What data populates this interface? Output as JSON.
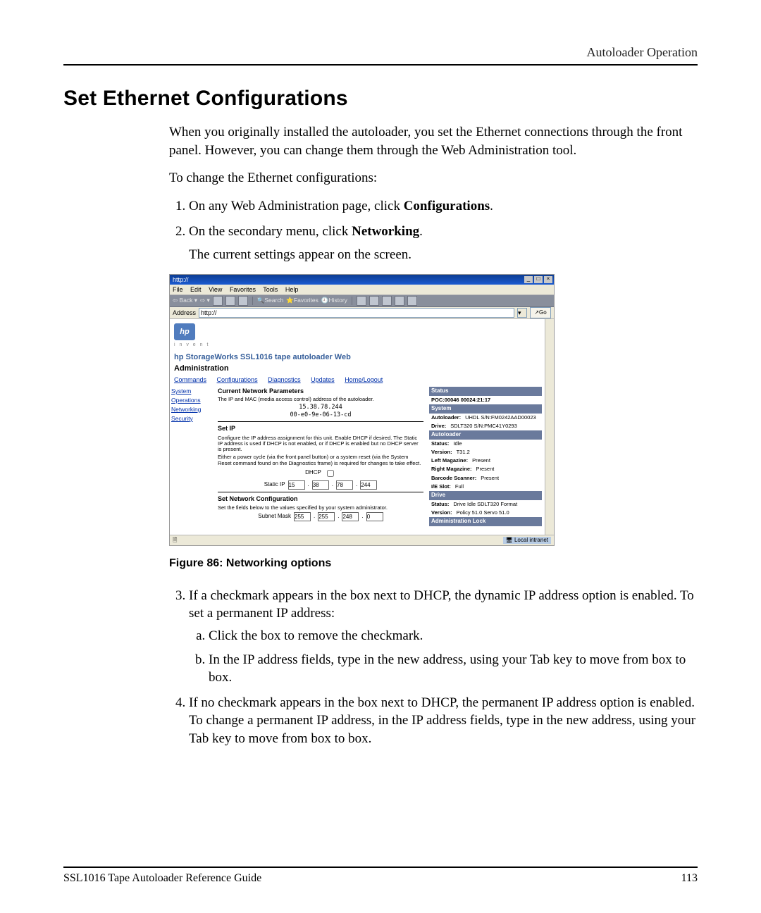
{
  "header": {
    "running_head": "Autoloader Operation"
  },
  "title": "Set Ethernet Configurations",
  "intro": "When you originally installed the autoloader, you set the Ethernet connections through the front panel. However, you can change them through the Web Administration tool.",
  "lead": "To change the Ethernet configurations:",
  "steps": {
    "s1_pre": "On any Web Administration page, click ",
    "s1_bold": "Configurations",
    "s1_post": ".",
    "s2_pre": "On the secondary menu, click ",
    "s2_bold": "Networking",
    "s2_post": ".",
    "s2_sub": "The current settings appear on the screen.",
    "s3": "If a checkmark appears in the box next to DHCP, the dynamic IP address option is enabled. To set a permanent IP address:",
    "s3a": "Click the box to remove the checkmark.",
    "s3b": "In the IP address fields, type in the new address, using your Tab key to move from box to box.",
    "s4": "If no checkmark appears in the box next to DHCP, the permanent IP address option is enabled. To change a permanent IP address, in the IP address fields, type in the new address, using your Tab key to move from box to box."
  },
  "figure": {
    "caption": "Figure 86:  Networking options"
  },
  "footer": {
    "left": "SSL1016 Tape Autoloader Reference Guide",
    "right": "113"
  },
  "screenshot": {
    "titlebar": "http://",
    "menubar": {
      "file": "File",
      "edit": "Edit",
      "view": "View",
      "favorites": "Favorites",
      "tools": "Tools",
      "help": "Help"
    },
    "toolbar": {
      "back": "Back",
      "search": "Search",
      "favorites": "Favorites",
      "history": "History"
    },
    "addressbar": {
      "label": "Address",
      "value": "http://",
      "go": "Go"
    },
    "logo_text": "hp",
    "invent": "i n v e n t",
    "product_title": "hp StorageWorks SSL1016 tape autoloader  Web",
    "product_title2": "Administration",
    "tabs": {
      "commands": "Commands",
      "configurations": "Configurations",
      "diagnostics": "Diagnostics",
      "updates": "Updates",
      "home": "Home/Logout"
    },
    "sidebar": {
      "system_ops": "System Operations",
      "networking": "Networking",
      "security": "Security"
    },
    "center": {
      "h_cnp": "Current Network Parameters",
      "cnp_desc": "The IP and MAC (media access control) address of the autoloader.",
      "ip": "15.38.78.244",
      "mac": "00-e0-9e-06-13-cd",
      "h_setip": "Set IP",
      "setip_desc": "Configure the IP address assignment for this unit. Enable DHCP if desired. The Static IP address is used if DHCP is not enabled, or if DHCP is enabled but no DHCP server is present.",
      "setip_note": "Either a power cycle (via the front panel button) or a system reset (via the System Reset command found on the Diagnostics frame) is required for changes to take effect.",
      "dhcp_label": "DHCP",
      "staticip_label": "Static IP",
      "ip1": "15",
      "ip2": "38",
      "ip3": "78",
      "ip4": "244",
      "h_netcfg": "Set Network Configuration",
      "netcfg_desc": "Set the fields below to the values specified by your system administrator.",
      "subnet_label": "Subnet Mask",
      "sm1": "255",
      "sm2": "255",
      "sm3": "248",
      "sm4": "0"
    },
    "right": {
      "status": "Status",
      "poc": "POC:00046 00024:21:17",
      "system": "System",
      "autoloader_k": "Autoloader:",
      "autoloader_v": "UHDL S/N:FM0242AAD00023",
      "drive_k": "Drive:",
      "drive_v": "SDLT320 S/N:PMC41Y0293",
      "autoloader2": "Autoloader",
      "status2_k": "Status:",
      "status2_v": "Idle",
      "version_k": "Version:",
      "version_v": "T31.2",
      "leftmag_k": "Left Magazine:",
      "leftmag_v": "Present",
      "rightmag_k": "Right Magazine:",
      "rightmag_v": "Present",
      "barcode_k": "Barcode Scanner:",
      "barcode_v": "Present",
      "ieslot_k": "I/E Slot:",
      "ieslot_v": "Full",
      "drive2": "Drive",
      "dstatus_k": "Status:",
      "dstatus_v": "Drive Idle SDLT320 Format",
      "dversion_k": "Version:",
      "dversion_v": "Policy 51.0 Servo 51.0",
      "admlock": "Administration Lock"
    },
    "statusbar": {
      "zone": "Local intranet"
    }
  }
}
